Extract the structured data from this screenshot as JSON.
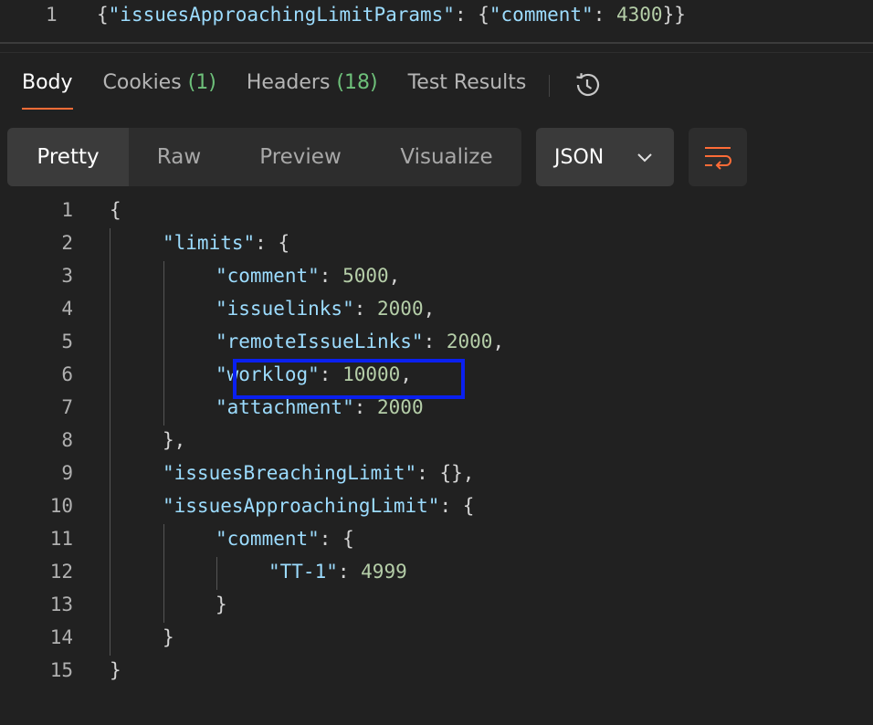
{
  "request_body": {
    "line_number": "1",
    "parts": [
      {
        "t": "{",
        "c": "p"
      },
      {
        "t": "\"issuesApproachingLimitParams\"",
        "c": "k"
      },
      {
        "t": ": {",
        "c": "p"
      },
      {
        "t": "\"comment\"",
        "c": "k"
      },
      {
        "t": ": ",
        "c": "p"
      },
      {
        "t": "4300",
        "c": "n"
      },
      {
        "t": "}}",
        "c": "p"
      }
    ]
  },
  "tabs": [
    {
      "label": "Body",
      "count": "",
      "active": true
    },
    {
      "label": "Cookies",
      "count": "(1)",
      "active": false
    },
    {
      "label": "Headers",
      "count": "(18)",
      "active": false
    },
    {
      "label": "Test Results",
      "count": "",
      "active": false
    }
  ],
  "icons": {
    "history": "history-icon",
    "chevron": "chevron-down-icon",
    "wrap": "wrap-lines-icon"
  },
  "view_modes": [
    "Pretty",
    "Raw",
    "Preview",
    "Visualize"
  ],
  "active_view_mode": "Pretty",
  "format": {
    "selected": "JSON"
  },
  "colors": {
    "accent": "#ff6c37",
    "key": "#9cdcfe",
    "number": "#b5cea8",
    "highlight": "#0a20f0"
  },
  "response_lines": [
    {
      "num": "1",
      "indent": 0,
      "parts": [
        {
          "t": "{",
          "c": "p"
        }
      ]
    },
    {
      "num": "2",
      "indent": 1,
      "parts": [
        {
          "t": "\"limits\"",
          "c": "k"
        },
        {
          "t": ": {",
          "c": "p"
        }
      ]
    },
    {
      "num": "3",
      "indent": 2,
      "parts": [
        {
          "t": "\"comment\"",
          "c": "k"
        },
        {
          "t": ": ",
          "c": "p"
        },
        {
          "t": "5000",
          "c": "n"
        },
        {
          "t": ",",
          "c": "p"
        }
      ]
    },
    {
      "num": "4",
      "indent": 2,
      "parts": [
        {
          "t": "\"issuelinks\"",
          "c": "k"
        },
        {
          "t": ": ",
          "c": "p"
        },
        {
          "t": "2000",
          "c": "n"
        },
        {
          "t": ",",
          "c": "p"
        }
      ]
    },
    {
      "num": "5",
      "indent": 2,
      "parts": [
        {
          "t": "\"remoteIssueLinks\"",
          "c": "k"
        },
        {
          "t": ": ",
          "c": "p"
        },
        {
          "t": "2000",
          "c": "n"
        },
        {
          "t": ",",
          "c": "p"
        }
      ]
    },
    {
      "num": "6",
      "indent": 2,
      "parts": [
        {
          "t": "\"worklog\"",
          "c": "k"
        },
        {
          "t": ": ",
          "c": "p"
        },
        {
          "t": "10000",
          "c": "n"
        },
        {
          "t": ",",
          "c": "p"
        }
      ]
    },
    {
      "num": "7",
      "indent": 2,
      "parts": [
        {
          "t": "\"attachment\"",
          "c": "k"
        },
        {
          "t": ": ",
          "c": "p"
        },
        {
          "t": "2000",
          "c": "n"
        }
      ]
    },
    {
      "num": "8",
      "indent": 1,
      "parts": [
        {
          "t": "},",
          "c": "p"
        }
      ]
    },
    {
      "num": "9",
      "indent": 1,
      "parts": [
        {
          "t": "\"issuesBreachingLimit\"",
          "c": "k"
        },
        {
          "t": ": {},",
          "c": "p"
        }
      ]
    },
    {
      "num": "10",
      "indent": 1,
      "parts": [
        {
          "t": "\"issuesApproachingLimit\"",
          "c": "k"
        },
        {
          "t": ": {",
          "c": "p"
        }
      ]
    },
    {
      "num": "11",
      "indent": 2,
      "parts": [
        {
          "t": "\"comment\"",
          "c": "k"
        },
        {
          "t": ": {",
          "c": "p"
        }
      ]
    },
    {
      "num": "12",
      "indent": 3,
      "parts": [
        {
          "t": "\"TT-1\"",
          "c": "k"
        },
        {
          "t": ": ",
          "c": "p"
        },
        {
          "t": "4999",
          "c": "n"
        }
      ]
    },
    {
      "num": "13",
      "indent": 2,
      "parts": [
        {
          "t": "}",
          "c": "p"
        }
      ]
    },
    {
      "num": "14",
      "indent": 1,
      "parts": [
        {
          "t": "}",
          "c": "p"
        }
      ]
    },
    {
      "num": "15",
      "indent": 0,
      "parts": [
        {
          "t": "}",
          "c": "p"
        }
      ]
    }
  ]
}
